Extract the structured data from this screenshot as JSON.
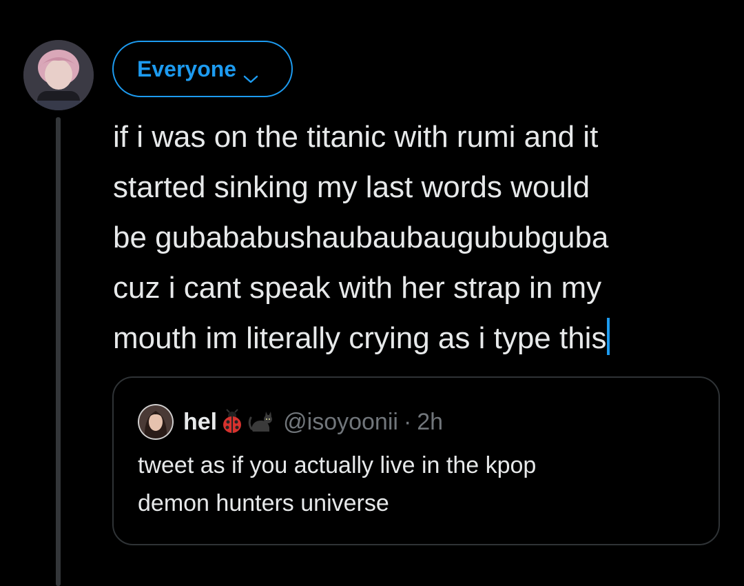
{
  "composer": {
    "audience_label": "Everyone",
    "audience_icon": "chevron-down-icon",
    "text_lines": [
      "if i was on the titanic with rumi and it",
      "started sinking my last words would",
      "be gubababushaubaubaugububguba",
      "cuz i cant speak with her strap in my",
      "mouth im literally crying as i type this"
    ]
  },
  "quoted_post": {
    "display_name": "hel",
    "emojis": [
      "ladybug-emoji",
      "cat-emoji"
    ],
    "handle": "@isoyoonii",
    "separator": "·",
    "time": "2h",
    "text_lines": [
      "tweet as if you actually live in the kpop",
      "demon hunters universe"
    ]
  },
  "colors": {
    "background": "#000000",
    "accent": "#1d9bf0",
    "text": "#e7e9ea",
    "muted": "#71767b",
    "border": "#2f3336"
  }
}
